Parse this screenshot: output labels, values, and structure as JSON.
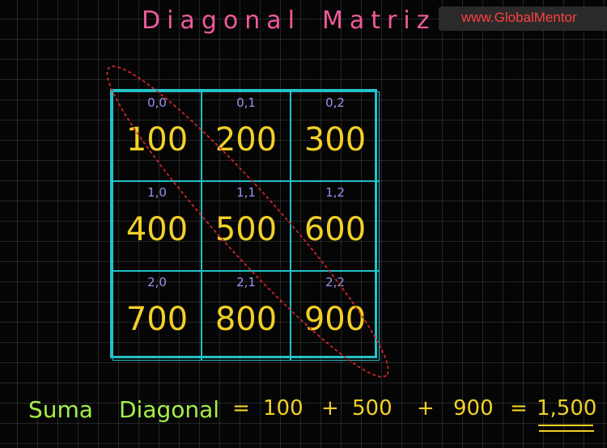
{
  "title": {
    "word1": "Diagonal",
    "word2": "Matriz"
  },
  "watermark": "www.GlobalMentor",
  "matrix": {
    "cells": [
      {
        "index": "0,0",
        "value": "100"
      },
      {
        "index": "0,1",
        "value": "200"
      },
      {
        "index": "0,2",
        "value": "300"
      },
      {
        "index": "1,0",
        "value": "400"
      },
      {
        "index": "1,1",
        "value": "500"
      },
      {
        "index": "1,2",
        "value": "600"
      },
      {
        "index": "2,0",
        "value": "700"
      },
      {
        "index": "2,1",
        "value": "800"
      },
      {
        "index": "2,2",
        "value": "900"
      }
    ]
  },
  "sum": {
    "label1": "Suma",
    "label2": "Diagonal",
    "equals": "=",
    "term1": "100",
    "plus": "+",
    "term2": "500",
    "term3": "900",
    "result": "1,500"
  },
  "colors": {
    "title": "#f05a9c",
    "grid": "#24c1c7",
    "index": "#9a92f0",
    "value": "#f2d027",
    "label": "#a4f04a",
    "ellipse": "#d0252a"
  }
}
